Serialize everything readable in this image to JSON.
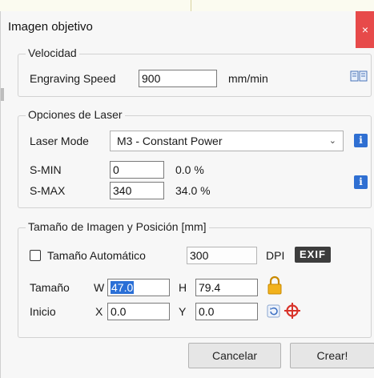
{
  "window": {
    "title": "Imagen objetivo",
    "close_label": "×"
  },
  "velocidad": {
    "legend": "Velocidad",
    "engraving_label": "Engraving Speed",
    "engraving_value": "900",
    "unit": "mm/min",
    "icon": "book-icon"
  },
  "laser": {
    "legend": "Opciones de Laser",
    "mode_label": "Laser Mode",
    "mode_value": "M3 - Constant Power",
    "smin_label": "S-MIN",
    "smin_value": "0",
    "smin_pct": "0.0 %",
    "smax_label": "S-MAX",
    "smax_value": "340",
    "smax_pct": "34.0 %",
    "info_label": "i"
  },
  "imagen": {
    "legend": "Tamaño de Imagen y Posición [mm]",
    "auto_label": "Tamaño Automático",
    "auto_checked": false,
    "dpi_value": "300",
    "dpi_label": "DPI",
    "exif_label": "EXIF",
    "size_label": "Tamaño",
    "w_label": "W",
    "w_value": "47.0",
    "h_label": "H",
    "h_value": "79.4",
    "start_label": "Inicio",
    "x_label": "X",
    "x_value": "0.0",
    "y_label": "Y",
    "y_value": "0.0"
  },
  "buttons": {
    "cancel": "Cancelar",
    "create": "Crear!"
  },
  "colors": {
    "accent": "#2a6fd6",
    "close": "#e74a4a",
    "lock": "#f2b21c",
    "target": "#d8332a"
  }
}
